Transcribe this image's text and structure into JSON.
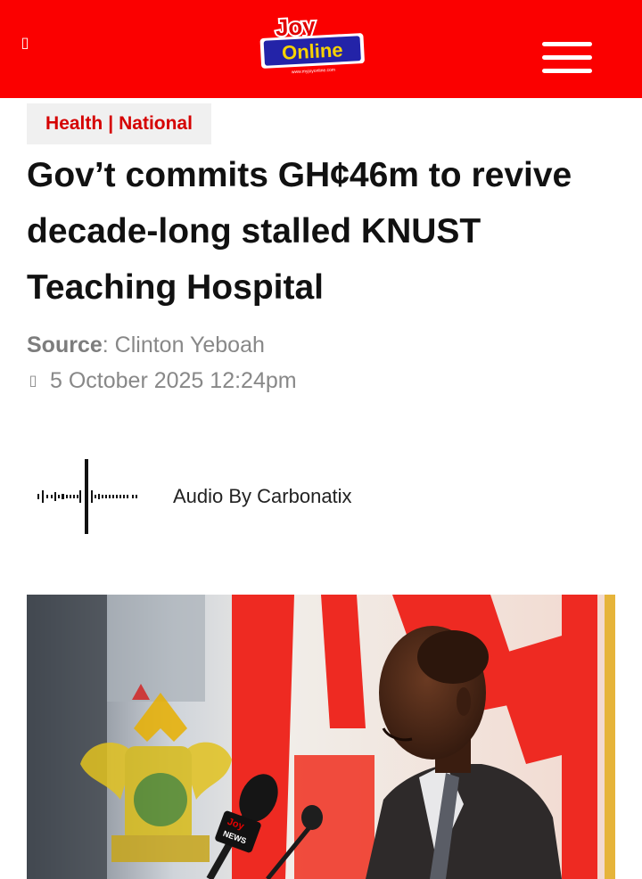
{
  "header": {
    "left_icon": "unknown-glyph-icon",
    "logo_text_top": "Joy",
    "logo_text_main": "Online",
    "logo_url_text": "www.myjoyonline.com",
    "menu_icon": "hamburger-menu-icon"
  },
  "article": {
    "category_primary": "Health",
    "category_separator": "|",
    "category_secondary": "National",
    "title": "Gov’t commits GH¢46m to revive decade-long stalled KNUST Teaching Hospital",
    "source_label": "Source",
    "source_sep": ":",
    "source_value": "Clinton Yeboah",
    "date_icon": "clock-icon",
    "date": "5 October 2025 12:24pm"
  },
  "audio": {
    "icon": "audio-waveform-icon",
    "label": "Audio By Carbonatix"
  },
  "hero": {
    "mic_logo_top": "Joy",
    "mic_logo_bottom": "NEWS"
  },
  "colors": {
    "brand_red": "#fb0000",
    "category_red": "#d50000",
    "title_text": "#111111",
    "meta_text": "#888888"
  }
}
